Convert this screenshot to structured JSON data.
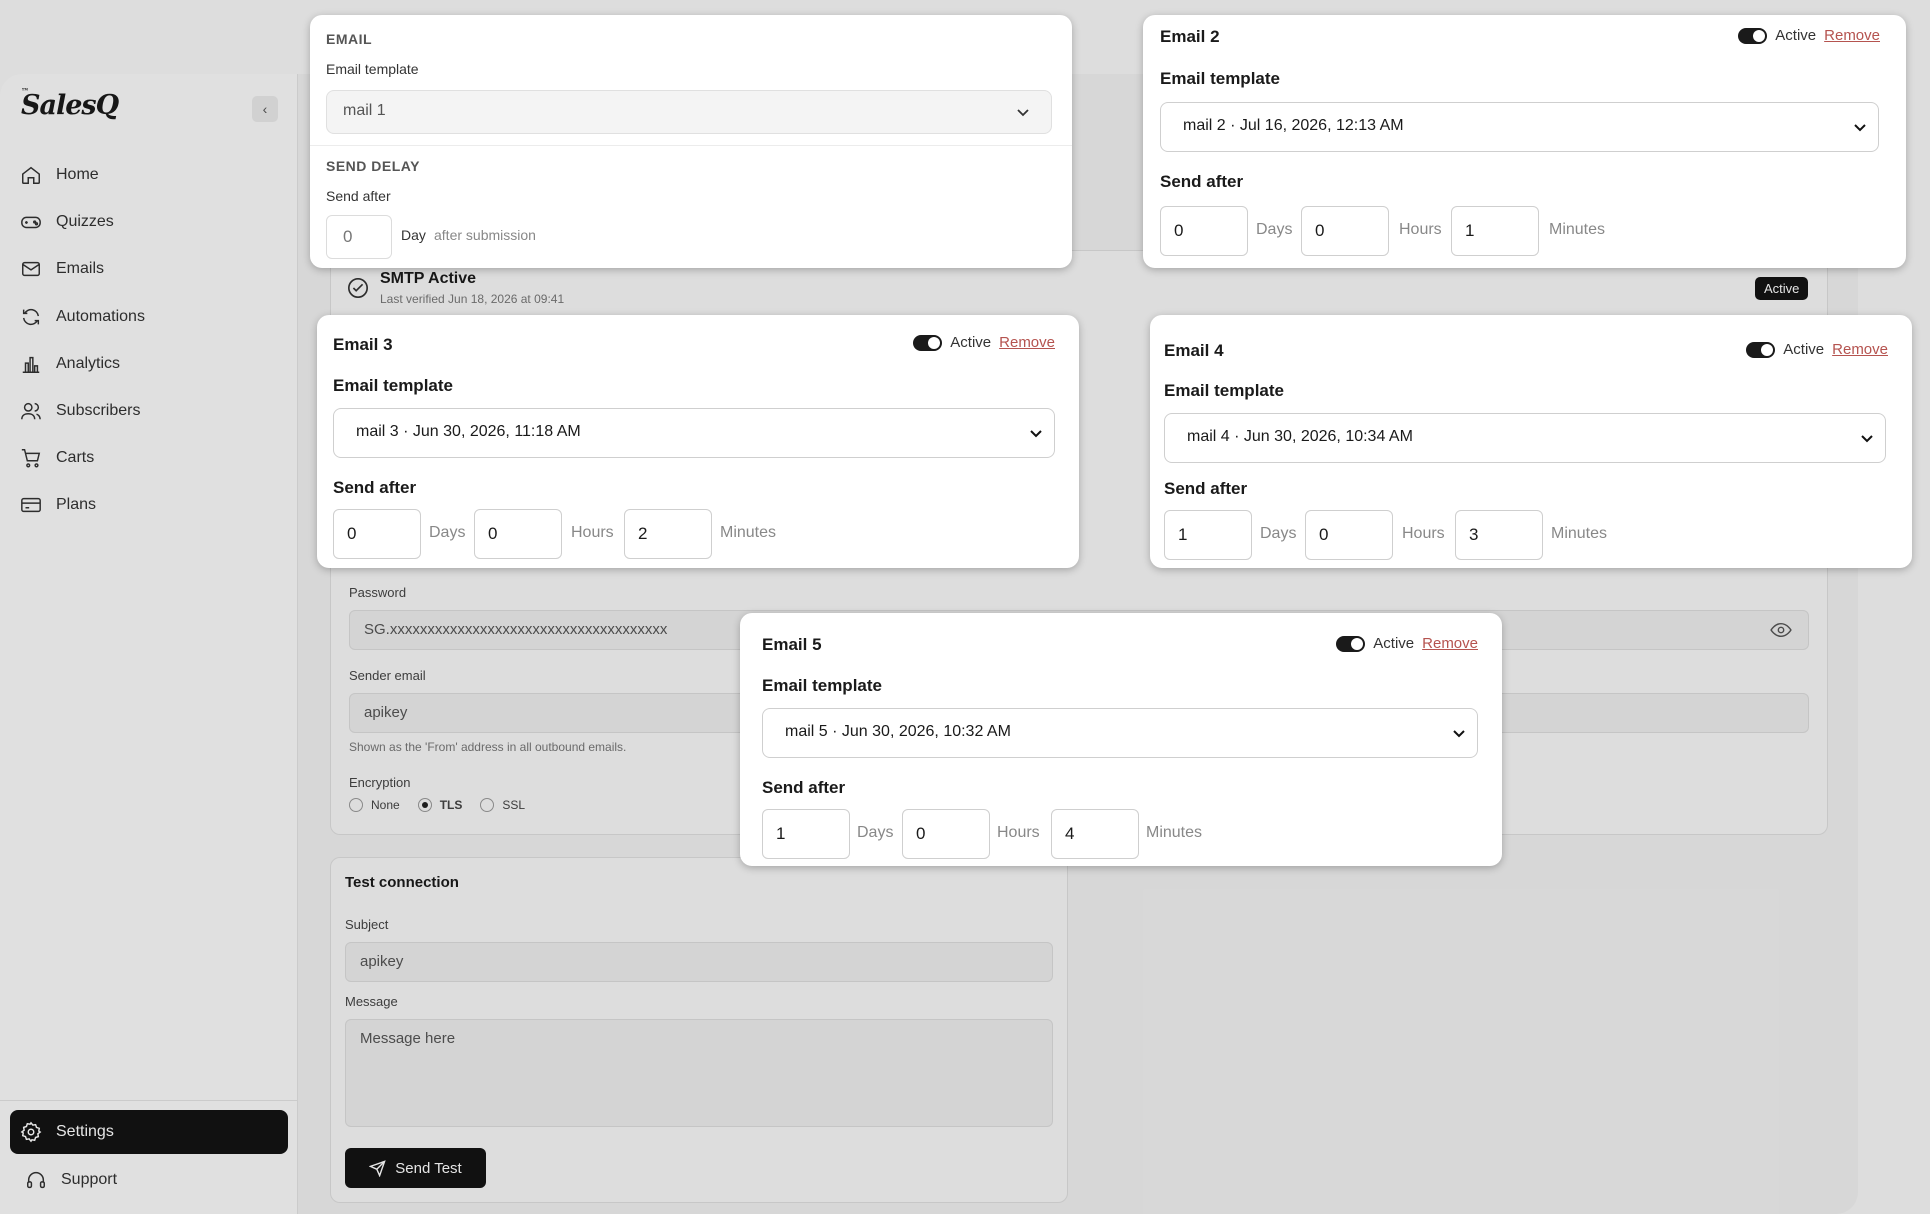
{
  "brand": {
    "logo_sup": "™",
    "logo": "SalesQ"
  },
  "sidebar": {
    "items": [
      {
        "label": "Home",
        "icon": "home-icon"
      },
      {
        "label": "Quizzes",
        "icon": "gamepad-icon"
      },
      {
        "label": "Emails",
        "icon": "mail-icon"
      },
      {
        "label": "Automations",
        "icon": "refresh-icon"
      },
      {
        "label": "Analytics",
        "icon": "bar-chart-icon"
      },
      {
        "label": "Subscribers",
        "icon": "users-icon"
      },
      {
        "label": "Carts",
        "icon": "cart-icon"
      },
      {
        "label": "Plans",
        "icon": "credit-card-icon"
      }
    ],
    "footer": [
      {
        "label": "Settings",
        "icon": "gear-icon",
        "active": true
      },
      {
        "label": "Support",
        "icon": "headset-icon"
      }
    ]
  },
  "smtp": {
    "title": "SMTP Active",
    "subtitle": "Last verified Jun 18, 2026 at 09:41",
    "badge": "Active",
    "password_label": "Password",
    "password_value": "SG.xxxxxxxxxxxxxxxxxxxxxxxxxxxxxxxxxxxxx",
    "sender_label": "Sender email",
    "sender_value": "apikey",
    "sender_help": "Shown as the 'From' address in all outbound emails.",
    "encryption_label": "Encryption",
    "encryption_options": [
      "None",
      "TLS",
      "SSL"
    ],
    "encryption_selected": "TLS"
  },
  "test": {
    "title": "Test connection",
    "subject_label": "Subject",
    "subject_value": "apikey",
    "message_label": "Message",
    "message_placeholder": "Message here",
    "button": "Send Test"
  },
  "email1": {
    "cap_email": "EMAIL",
    "template_label": "Email template",
    "template_value": "mail 1",
    "cap_delay": "SEND DELAY",
    "send_after_label": "Send after",
    "days": "0",
    "day_unit": "Day",
    "after_text": "after submission"
  },
  "emails": [
    {
      "title": "Email 2",
      "active": "Active",
      "remove": "Remove",
      "template_label": "Email template",
      "template_value": "mail 2 · Jul 16, 2026, 12:13 AM",
      "send_after": "Send after",
      "days": "0",
      "hours": "0",
      "minutes": "1"
    },
    {
      "title": "Email 3",
      "active": "Active",
      "remove": "Remove",
      "template_label": "Email template",
      "template_value": "mail 3 · Jun 30, 2026, 11:18 AM",
      "send_after": "Send after",
      "days": "0",
      "hours": "0",
      "minutes": "2"
    },
    {
      "title": "Email 4",
      "active": "Active",
      "remove": "Remove",
      "template_label": "Email template",
      "template_value": "mail 4 · Jun 30, 2026, 10:34 AM",
      "send_after": "Send after",
      "days": "1",
      "hours": "0",
      "minutes": "3"
    },
    {
      "title": "Email 5",
      "active": "Active",
      "remove": "Remove",
      "template_label": "Email template",
      "template_value": "mail 5 · Jun 30, 2026, 10:32 AM",
      "send_after": "Send after",
      "days": "1",
      "hours": "0",
      "minutes": "4"
    }
  ],
  "units": {
    "days": "Days",
    "hours": "Hours",
    "minutes": "Minutes"
  }
}
